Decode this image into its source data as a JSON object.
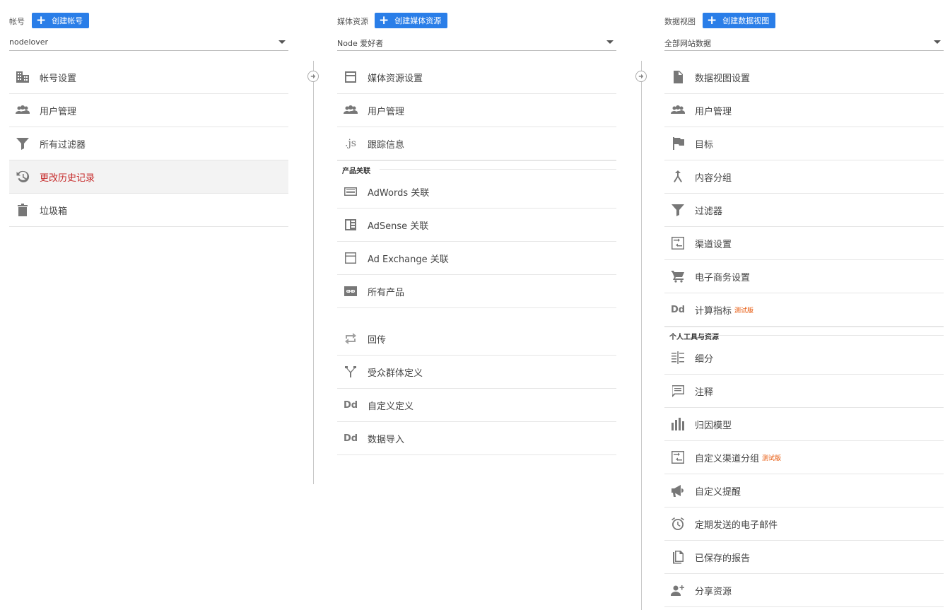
{
  "account": {
    "title": "帐号",
    "create_label": "创建帐号",
    "selected": "nodelover",
    "items": [
      {
        "icon": "building-icon",
        "label": "帐号设置"
      },
      {
        "icon": "people-icon",
        "label": "用户管理"
      },
      {
        "icon": "filter-icon",
        "label": "所有过滤器"
      },
      {
        "icon": "history-icon",
        "label": "更改历史记录",
        "active": true
      },
      {
        "icon": "trash-icon",
        "label": "垃圾箱"
      }
    ]
  },
  "property": {
    "title": "媒体资源",
    "create_label": "创建媒体资源",
    "selected": "Node 爱好者",
    "items": [
      {
        "icon": "window-icon",
        "label": "媒体资源设置"
      },
      {
        "icon": "people-icon",
        "label": "用户管理"
      },
      {
        "icon": "js-icon",
        "label": "跟踪信息",
        "glyph": ".js"
      }
    ],
    "section_label": "产品关联",
    "product_items": [
      {
        "icon": "adwords-icon",
        "label": "AdWords 关联"
      },
      {
        "icon": "adsense-icon",
        "label": "AdSense 关联"
      },
      {
        "icon": "adexchange-icon",
        "label": "Ad Exchange 关联"
      },
      {
        "icon": "link-icon",
        "label": "所有产品"
      }
    ],
    "more_items": [
      {
        "icon": "postback-icon",
        "label": "回传"
      },
      {
        "icon": "audience-icon",
        "label": "受众群体定义"
      },
      {
        "icon": "dd-icon",
        "label": "自定义定义",
        "glyph": "Dd"
      },
      {
        "icon": "dd-icon",
        "label": "数据导入",
        "glyph": "Dd"
      }
    ]
  },
  "view": {
    "title": "数据视图",
    "create_label": "创建数据视图",
    "selected": "全部网站数据",
    "items": [
      {
        "icon": "document-icon",
        "label": "数据视图设置"
      },
      {
        "icon": "people-icon",
        "label": "用户管理"
      },
      {
        "icon": "flag-icon",
        "label": "目标"
      },
      {
        "icon": "merge-icon",
        "label": "内容分组"
      },
      {
        "icon": "filter-icon",
        "label": "过滤器"
      },
      {
        "icon": "channel-icon",
        "label": "渠道设置"
      },
      {
        "icon": "cart-icon",
        "label": "电子商务设置"
      },
      {
        "icon": "dd-icon",
        "label": "计算指标",
        "glyph": "Dd",
        "beta": "测试版"
      }
    ],
    "section_label": "个人工具与资源",
    "tool_items": [
      {
        "icon": "segment-icon",
        "label": "细分"
      },
      {
        "icon": "comment-icon",
        "label": "注释"
      },
      {
        "icon": "bar-chart-icon",
        "label": "归因模型"
      },
      {
        "icon": "channel-icon",
        "label": "自定义渠道分组",
        "beta": "测试版"
      },
      {
        "icon": "megaphone-icon",
        "label": "自定义提醒"
      },
      {
        "icon": "alarm-icon",
        "label": "定期发送的电子邮件"
      },
      {
        "icon": "report-icon",
        "label": "已保存的报告"
      },
      {
        "icon": "share-user-icon",
        "label": "分享资源"
      }
    ]
  },
  "colors": {
    "accent": "#2a7ee8",
    "active_text": "#c62828",
    "beta": "#e65100"
  }
}
